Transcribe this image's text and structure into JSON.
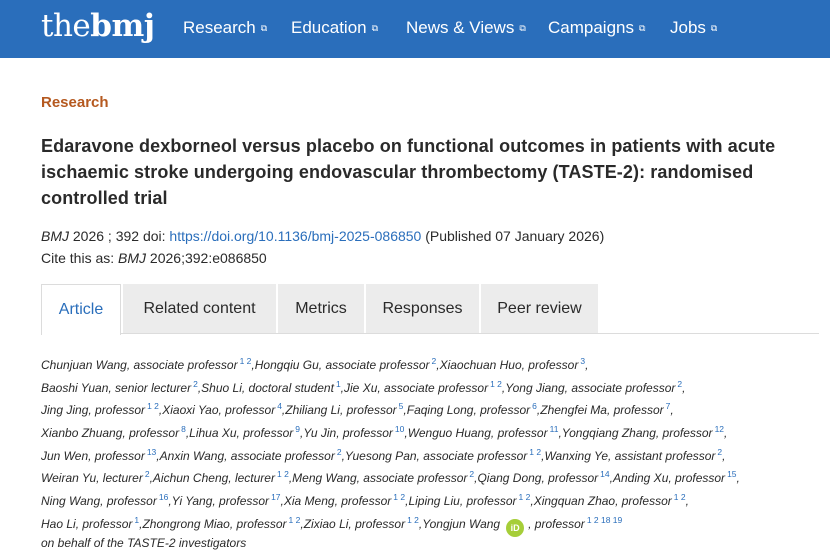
{
  "header": {
    "logo_part1": "the",
    "logo_part2": "bmj",
    "nav": [
      "Research",
      "Education",
      "News & Views",
      "Campaigns",
      "Jobs"
    ]
  },
  "article": {
    "section": "Research",
    "title": "Edaravone dexborneol versus placebo on functional outcomes in patients with acute ischaemic stroke undergoing endovascular thrombectomy (TASTE-2): randomised controlled trial",
    "journal": "BMJ",
    "citation_numbers": "2026 ; 392  doi:",
    "doi_link": "https://doi.org/10.1136/bmj-2025-086850",
    "published": "(Published 07 January 2026)",
    "cite_prefix": "Cite this as:",
    "cite_journal": "BMJ",
    "cite_ref": "2026;392:e086850",
    "on_behalf": "on behalf of the TASTE-2 investigators"
  },
  "tabs": [
    "Article",
    "Related content",
    "Metrics",
    "Responses",
    "Peer review"
  ],
  "authors": [
    [
      [
        "Chunjuan Wang, associate professor",
        "1  2"
      ],
      [
        "Hongqiu Gu, associate professor",
        "2"
      ],
      [
        "Xiaochuan Huo, professor",
        "3"
      ]
    ],
    [
      [
        "Baoshi Yuan, senior lecturer",
        "2"
      ],
      [
        "Shuo Li, doctoral student",
        "1"
      ],
      [
        "Jie Xu, associate professor",
        "1  2"
      ],
      [
        "Yong Jiang, associate professor",
        "2"
      ]
    ],
    [
      [
        "Jing Jing, professor",
        "1  2"
      ],
      [
        "Xiaoxi Yao, professor",
        "4"
      ],
      [
        "Zhiliang Li, professor",
        "5"
      ],
      [
        "Faqing Long, professor",
        "6"
      ],
      [
        "Zhengfei Ma, professor",
        "7"
      ]
    ],
    [
      [
        "Xianbo Zhuang, professor",
        "8"
      ],
      [
        "Lihua Xu, professor",
        "9"
      ],
      [
        "Yu Jin, professor",
        "10"
      ],
      [
        "Wenguo Huang, professor",
        "11"
      ],
      [
        "Yongqiang Zhang, professor",
        "12"
      ]
    ],
    [
      [
        "Jun Wen, professor",
        "13"
      ],
      [
        "Anxin Wang, associate professor",
        "2"
      ],
      [
        "Yuesong Pan, associate professor",
        "1  2"
      ],
      [
        "Wanxing Ye, assistant professor",
        "2"
      ]
    ],
    [
      [
        "Weiran Yu, lecturer",
        "2"
      ],
      [
        "Aichun Cheng, lecturer",
        "1  2"
      ],
      [
        "Meng Wang, associate professor",
        "2"
      ],
      [
        "Qiang Dong, professor",
        "14"
      ],
      [
        "Anding Xu, professor",
        "15"
      ]
    ],
    [
      [
        "Ning Wang, professor",
        "16"
      ],
      [
        "Yi Yang, professor",
        "17"
      ],
      [
        "Xia Meng, professor",
        "1  2"
      ],
      [
        "Liping Liu, professor",
        "1  2"
      ],
      [
        "Xingquan Zhao, professor",
        "1  2"
      ]
    ],
    [
      [
        "Hao Li, professor",
        "1"
      ],
      [
        "Zhongrong Miao, professor",
        "1  2"
      ],
      [
        "Zixiao Li, professor",
        "1  2"
      ],
      [
        "Yongjun Wang",
        ""
      ],
      [
        ", professor",
        "1  2  18  19"
      ]
    ]
  ],
  "orcid_label": "iD",
  "colors": {
    "header_bg": "#2a6ebb",
    "section": "#b5591f",
    "link": "#2a6ebb",
    "orcid": "#a6ce39"
  }
}
